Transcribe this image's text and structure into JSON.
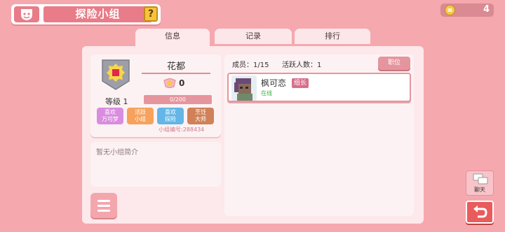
{
  "header": {
    "title": "探险小组",
    "help_label": "?",
    "currency_amount": "4"
  },
  "tabs": [
    {
      "label": "信息"
    },
    {
      "label": "记录"
    },
    {
      "label": "排行"
    }
  ],
  "group": {
    "name": "花都",
    "score": "0",
    "level_label": "等级 1",
    "exp_text": "0/200",
    "exp_fraction": 0,
    "tags": [
      {
        "line1": "喜欢",
        "line2": "万可梦",
        "color": "#d98ce0"
      },
      {
        "line1": "活跃",
        "line2": "小组",
        "color": "#f6a25d"
      },
      {
        "line1": "喜欢",
        "line2": "探险",
        "color": "#63b6e6"
      },
      {
        "line1": "烹饪",
        "line2": "大师",
        "color": "#d08158"
      }
    ],
    "id_label": "小组编号:",
    "id_value": "288434",
    "description": "暂无小组简介"
  },
  "members": {
    "count_label": "成员：",
    "count_value": "1/15",
    "active_label": "活跃人数：",
    "active_value": "1",
    "position_button": "职位",
    "list": [
      {
        "name": "枫可恋",
        "role": "组长",
        "status": "在线"
      }
    ]
  },
  "side": {
    "chat_label": "聊天"
  },
  "colors": {
    "background": "#f5a8ae",
    "accent": "#e87c88",
    "online": "#3cb043"
  }
}
